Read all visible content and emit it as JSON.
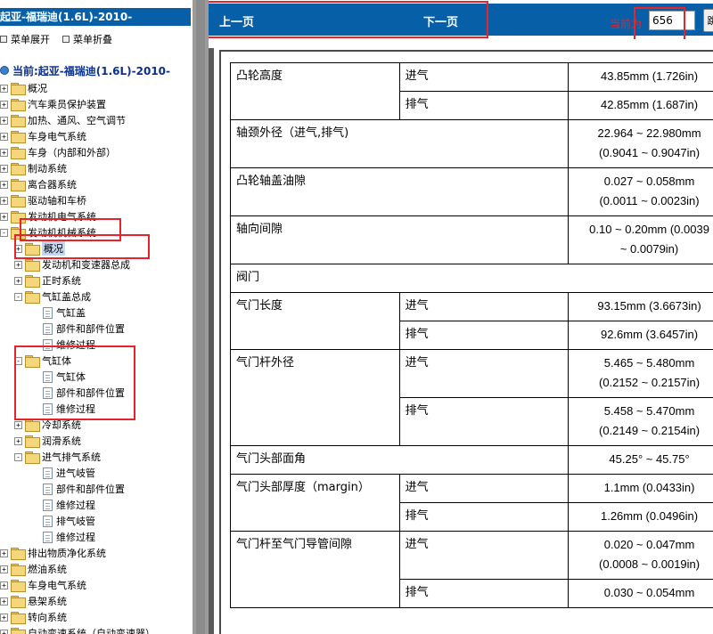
{
  "left_panel": {
    "title": "起亚-福瑞迪(1.6L)-2010-",
    "toolbar": {
      "expand": "菜单展开",
      "collapse": "菜单折叠"
    },
    "current": "当前:起亚-福瑞迪(1.6L)-2010-",
    "tree": [
      {
        "label": "概况",
        "level": 0,
        "kind": "folder",
        "toggle": "+"
      },
      {
        "label": "汽车乘员保护装置",
        "level": 0,
        "kind": "folder",
        "toggle": "+"
      },
      {
        "label": "加热、通风、空气调节",
        "level": 0,
        "kind": "folder",
        "toggle": "+"
      },
      {
        "label": "车身电气系统",
        "level": 0,
        "kind": "folder",
        "toggle": "+"
      },
      {
        "label": "车身（内部和外部）",
        "level": 0,
        "kind": "folder",
        "toggle": "+"
      },
      {
        "label": "制动系统",
        "level": 0,
        "kind": "folder",
        "toggle": "+"
      },
      {
        "label": "离合器系统",
        "level": 0,
        "kind": "folder",
        "toggle": "+"
      },
      {
        "label": "驱动轴和车桥",
        "level": 0,
        "kind": "folder",
        "toggle": "+"
      },
      {
        "label": "发动机电气系统",
        "level": 0,
        "kind": "folder",
        "toggle": "+"
      },
      {
        "label": "发动机机械系统",
        "level": 0,
        "kind": "folder",
        "toggle": "-"
      },
      {
        "label": "概况",
        "level": 1,
        "kind": "folder",
        "toggle": "+",
        "selected": true
      },
      {
        "label": "发动机和变速器总成",
        "level": 1,
        "kind": "folder",
        "toggle": "+"
      },
      {
        "label": "正时系统",
        "level": 1,
        "kind": "folder",
        "toggle": "+"
      },
      {
        "label": "气缸盖总成",
        "level": 1,
        "kind": "folder",
        "toggle": "-"
      },
      {
        "label": "气缸盖",
        "level": 2,
        "kind": "doc"
      },
      {
        "label": "部件和部件位置",
        "level": 2,
        "kind": "doc"
      },
      {
        "label": "维修过程",
        "level": 2,
        "kind": "doc"
      },
      {
        "label": "气缸体",
        "level": 1,
        "kind": "folder",
        "toggle": "-"
      },
      {
        "label": "气缸体",
        "level": 2,
        "kind": "doc"
      },
      {
        "label": "部件和部件位置",
        "level": 2,
        "kind": "doc"
      },
      {
        "label": "维修过程",
        "level": 2,
        "kind": "doc"
      },
      {
        "label": "冷却系统",
        "level": 1,
        "kind": "folder",
        "toggle": "+"
      },
      {
        "label": "润滑系统",
        "level": 1,
        "kind": "folder",
        "toggle": "+"
      },
      {
        "label": "进气排气系统",
        "level": 1,
        "kind": "folder",
        "toggle": "-"
      },
      {
        "label": "进气岐管",
        "level": 2,
        "kind": "doc"
      },
      {
        "label": "部件和部件位置",
        "level": 2,
        "kind": "doc"
      },
      {
        "label": "维修过程",
        "level": 2,
        "kind": "doc"
      },
      {
        "label": "排气岐管",
        "level": 2,
        "kind": "doc"
      },
      {
        "label": "维修过程",
        "level": 2,
        "kind": "doc"
      },
      {
        "label": "排出物质净化系统",
        "level": 0,
        "kind": "folder",
        "toggle": "+"
      },
      {
        "label": "燃油系统",
        "level": 0,
        "kind": "folder",
        "toggle": "+"
      },
      {
        "label": "车身电气系统",
        "level": 0,
        "kind": "folder",
        "toggle": "+"
      },
      {
        "label": "悬架系统",
        "level": 0,
        "kind": "folder",
        "toggle": "+"
      },
      {
        "label": "转向系统",
        "level": 0,
        "kind": "folder",
        "toggle": "+"
      },
      {
        "label": "自动变速系统（自动变速器）",
        "level": 0,
        "kind": "folder",
        "toggle": "+"
      }
    ]
  },
  "nav": {
    "prev": "上一页",
    "next": "下一页",
    "page_label": "当前为",
    "page_value": "656",
    "go": "跳"
  },
  "spec_table": [
    {
      "name": "凸轮高度",
      "rows": [
        {
          "sub": "进气",
          "value": [
            "43.85mm (1.726in)"
          ]
        },
        {
          "sub": "排气",
          "value": [
            "42.85mm (1.687in)"
          ]
        }
      ]
    },
    {
      "name": "轴颈外径（进气,排气)",
      "rows": [
        {
          "sub": "",
          "value": [
            "22.964 ~ 22.980mm",
            "(0.9041 ~ 0.9047in)"
          ]
        }
      ]
    },
    {
      "name": "凸轮轴盖油隙",
      "rows": [
        {
          "sub": "",
          "value": [
            "0.027 ~ 0.058mm",
            "(0.0011 ~ 0.0023in)"
          ]
        }
      ]
    },
    {
      "name": "轴向间隙",
      "rows": [
        {
          "sub": "",
          "value": [
            "0.10 ~ 0.20mm (0.0039",
            "~ 0.0079in)"
          ]
        }
      ]
    },
    {
      "name": "阀门",
      "section": true,
      "rows": []
    },
    {
      "name": "气门长度",
      "rows": [
        {
          "sub": "进气",
          "value": [
            "93.15mm (3.6673in)"
          ]
        },
        {
          "sub": "排气",
          "value": [
            "92.6mm (3.6457in)"
          ]
        }
      ]
    },
    {
      "name": "气门杆外径",
      "rows": [
        {
          "sub": "进气",
          "value": [
            "5.465 ~ 5.480mm",
            "(0.2152 ~ 0.2157in)"
          ]
        },
        {
          "sub": "排气",
          "value": [
            "5.458 ~ 5.470mm",
            "(0.2149 ~ 0.2154in)"
          ]
        }
      ]
    },
    {
      "name": "气门头部面角",
      "rows": [
        {
          "sub": "",
          "value": [
            "45.25° ~ 45.75°"
          ]
        }
      ]
    },
    {
      "name": "气门头部厚度（margin）",
      "rows": [
        {
          "sub": "进气",
          "value": [
            "1.1mm (0.0433in)"
          ]
        },
        {
          "sub": "排气",
          "value": [
            "1.26mm (0.0496in)"
          ]
        }
      ]
    },
    {
      "name": "气门杆至气门导管间隙",
      "rows": [
        {
          "sub": "进气",
          "value": [
            "0.020 ~ 0.047mm",
            "(0.0008 ~ 0.0019in)"
          ]
        },
        {
          "sub": "排气",
          "value": [
            "0.030 ~ 0.054mm"
          ]
        }
      ]
    }
  ]
}
